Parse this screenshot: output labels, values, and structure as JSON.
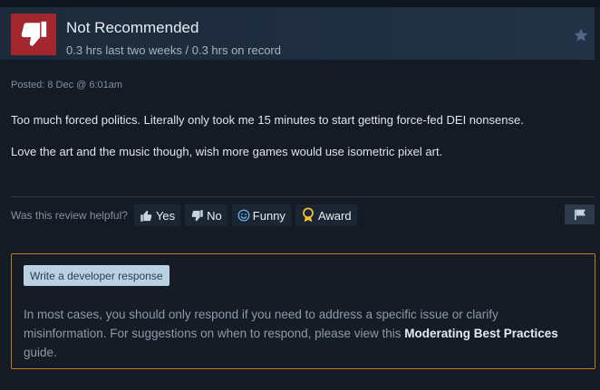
{
  "review": {
    "rating": "Not Recommended",
    "hours": "0.3 hrs last two weeks / 0.3 hrs on record",
    "posted": "Posted: 8 Dec @ 6:01am",
    "body": [
      "Too much forced politics. Literally only took me 15 minutes to start getting force-fed DEI nonsense.",
      "Love the art and the music though, wish more games would use isometric pixel art."
    ],
    "icons": {
      "rating": "thumbs-down-icon",
      "star": "star-icon"
    }
  },
  "helpful": {
    "label": "Was this review helpful?",
    "yes": "Yes",
    "no": "No",
    "funny": "Funny",
    "award": "Award"
  },
  "developer": {
    "button": "Write a developer response",
    "note_before": "In most cases, you should only respond if you need to address a specific issue or clarify misinformation. For suggestions on when to respond, please view this ",
    "note_link": "Moderating Best Practices",
    "note_after": " guide."
  },
  "colors": {
    "background": "#141b25",
    "not_recommended": "#a3282d",
    "panel_border": "#c27a1d",
    "dev_button": "#b9d1e3"
  }
}
